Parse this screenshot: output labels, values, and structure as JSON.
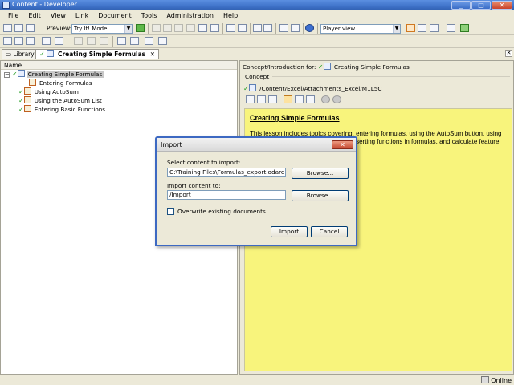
{
  "window": {
    "title": "Content - Developer"
  },
  "menu": [
    "File",
    "Edit",
    "View",
    "Link",
    "Document",
    "Tools",
    "Administration",
    "Help"
  ],
  "toolbar": {
    "preview_label": "Preview:",
    "preview_mode": "Try It! Mode",
    "view_mode": "Player view"
  },
  "tabs": {
    "library": "Library",
    "document": "Creating Simple Formulas"
  },
  "left_pane": {
    "header": "Name",
    "tree": [
      {
        "label": "Creating Simple Formulas",
        "level": 0,
        "selected": true,
        "checked": true
      },
      {
        "label": "Entering Formulas",
        "level": 1,
        "selected": false,
        "checked": false
      },
      {
        "label": "Using AutoSum",
        "level": 1,
        "selected": false,
        "checked": true
      },
      {
        "label": "Using the AutoSum List",
        "level": 1,
        "selected": false,
        "checked": true
      },
      {
        "label": "Entering Basic Functions",
        "level": 1,
        "selected": false,
        "checked": true
      }
    ]
  },
  "right_pane": {
    "concept_for_label": "Concept/Introduction for:",
    "concept_for_value": "Creating Simple Formulas",
    "group_label": "Concept",
    "path": "/Content/Excel/Attachments_Excel/M1L5C",
    "content_title": "Creating Simple Formulas",
    "content_body": "This lesson includes topics covering, entering formulas, using the AutoSum button, using the AutoSum list to enter functions, inserting functions in formulas, and calculate feature, using range borders to modify"
  },
  "dialog": {
    "title": "Import",
    "select_label": "Select content to import:",
    "select_value": "C:\\Training Files\\Formulas_export.odarc",
    "browse1": "Browse...",
    "import_to_label": "Import content to:",
    "import_to_value": "/Import",
    "browse2": "Browse...",
    "overwrite_label": "Overwrite existing documents",
    "overwrite_checked": false,
    "import_button": "Import",
    "cancel_button": "Cancel"
  },
  "status": {
    "online": "Online"
  },
  "colors": {
    "note_background": "#f8f47c",
    "titlebar": "#3f73c9",
    "check": "#1a9a1a"
  }
}
